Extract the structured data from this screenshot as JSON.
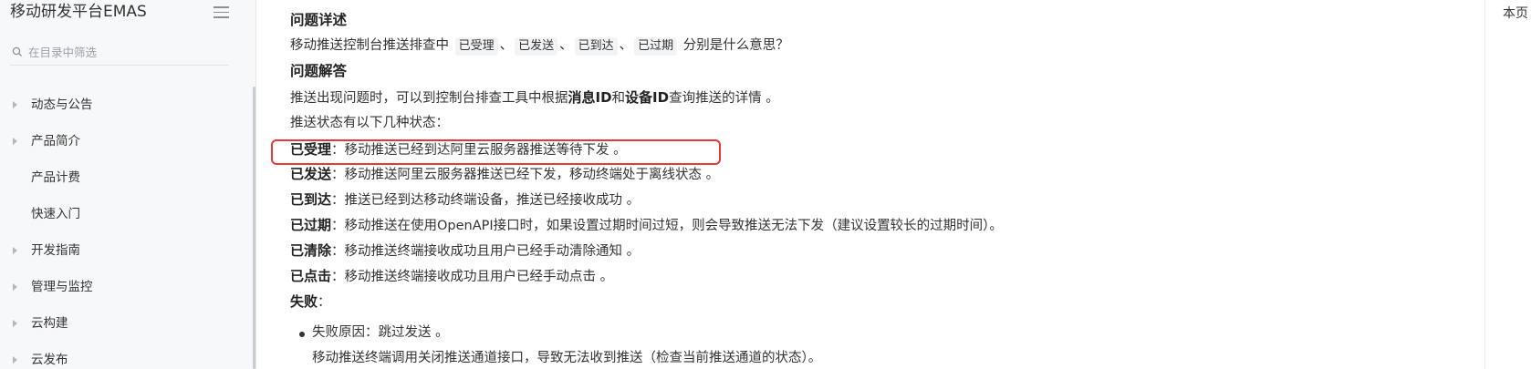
{
  "sidebar": {
    "title": "移动研发平台EMAS",
    "search_placeholder": "在目录中筛选",
    "items": [
      {
        "label": "动态与公告",
        "has_children": true
      },
      {
        "label": "产品简介",
        "has_children": true
      },
      {
        "label": "产品计费",
        "has_children": false
      },
      {
        "label": "快速入门",
        "has_children": false
      },
      {
        "label": "开发指南",
        "has_children": true
      },
      {
        "label": "管理与监控",
        "has_children": true
      },
      {
        "label": "云构建",
        "has_children": true
      },
      {
        "label": "云发布",
        "has_children": true
      }
    ]
  },
  "content": {
    "q_heading": "问题详述",
    "q_text_prefix": "移动推送控制台推送排查中",
    "q_codes": [
      "已受理",
      "已发送",
      "已到达",
      "已过期"
    ],
    "q_sep": "、",
    "q_text_suffix": "分别是什么意思？",
    "a_heading": "问题解答",
    "a_text_1": "推送出现问题时，可以到控制台",
    "a_code_1": "排查工具",
    "a_text_2": "中根据",
    "a_bold_1": "消息ID",
    "a_text_3": "和",
    "a_bold_2": "设备ID",
    "a_text_4": "查询推送的详情 。",
    "status_intro": "推送状态有以下几种状态：",
    "statuses": [
      {
        "term": "已受理",
        "desc": "：移动推送已经到达阿里云服务器推送等待下发 。"
      },
      {
        "term": "已发送",
        "desc": "：移动推送阿里云服务器推送已经下发，移动终端处于离线状态 。"
      },
      {
        "term": "已到达",
        "desc": "：推送已经到达移动终端设备，推送已经接收成功 。"
      },
      {
        "term": "已过期",
        "desc": "：移动推送在使用OpenAPI接口时，如果设置过期时间过短，则会导致推送无法下发（建议设置较长的过期时间）。"
      },
      {
        "term": "已清除",
        "desc": "：移动推送终端接收成功且用户已经手动清除通知 。"
      },
      {
        "term": "已点击",
        "desc": "：移动推送终端接收成功且用户已经手动点击 。"
      }
    ],
    "fail_term": "失败",
    "fail_colon": "：",
    "fail_reason": "失败原因：跳过发送 。",
    "fail_detail": "移动推送终端调用关闭推送通道接口，导致无法收到推送（检查当前推送通道的状态）。"
  },
  "toc": {
    "label": "本页"
  },
  "colors": {
    "highlight_border": "#e53935",
    "sidebar_bg": "#f7f8fa"
  }
}
